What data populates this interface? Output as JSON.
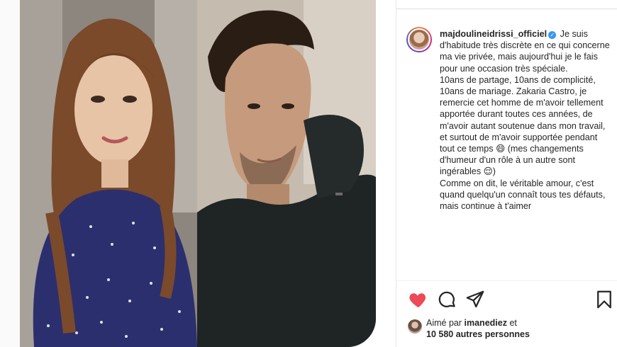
{
  "post": {
    "username": "majdoulineidrissi_officiel",
    "caption_lines": [
      "Je suis d'habitude très discrète en ce qui concerne ma vie privée, mais aujourd'hui je le fais pour une occasion très spéciale.",
      "10ans de partage, 10ans de complicité, 10ans de mariage. Zakaria Castro, je remercie cet homme de m'avoir tellement apportée durant toutes ces années, de m'avoir autant soutenue dans mon travail, et surtout de m'avoir supportée pendant tout ce temps 😄 (mes changements d'humeur d'un rôle à un autre sont ingérables 😌)",
      "Comme on dit, le véritable amour, c'est quand quelqu'un connaît tous tes défauts, mais continue à t'aimer"
    ],
    "likes_prefix": "Aimé par",
    "likes_user": "imanediez",
    "likes_suffix": "et",
    "likes_count_text": "10 580 autres personnes"
  },
  "icons": {
    "like": "heart-filled-icon",
    "comment": "comment-icon",
    "share": "send-icon",
    "save": "bookmark-icon",
    "verified": "verified-badge-icon"
  },
  "colors": {
    "like": "#ed4956",
    "verified": "#3897f0",
    "text": "#262626"
  },
  "verified_glyph": "✓"
}
